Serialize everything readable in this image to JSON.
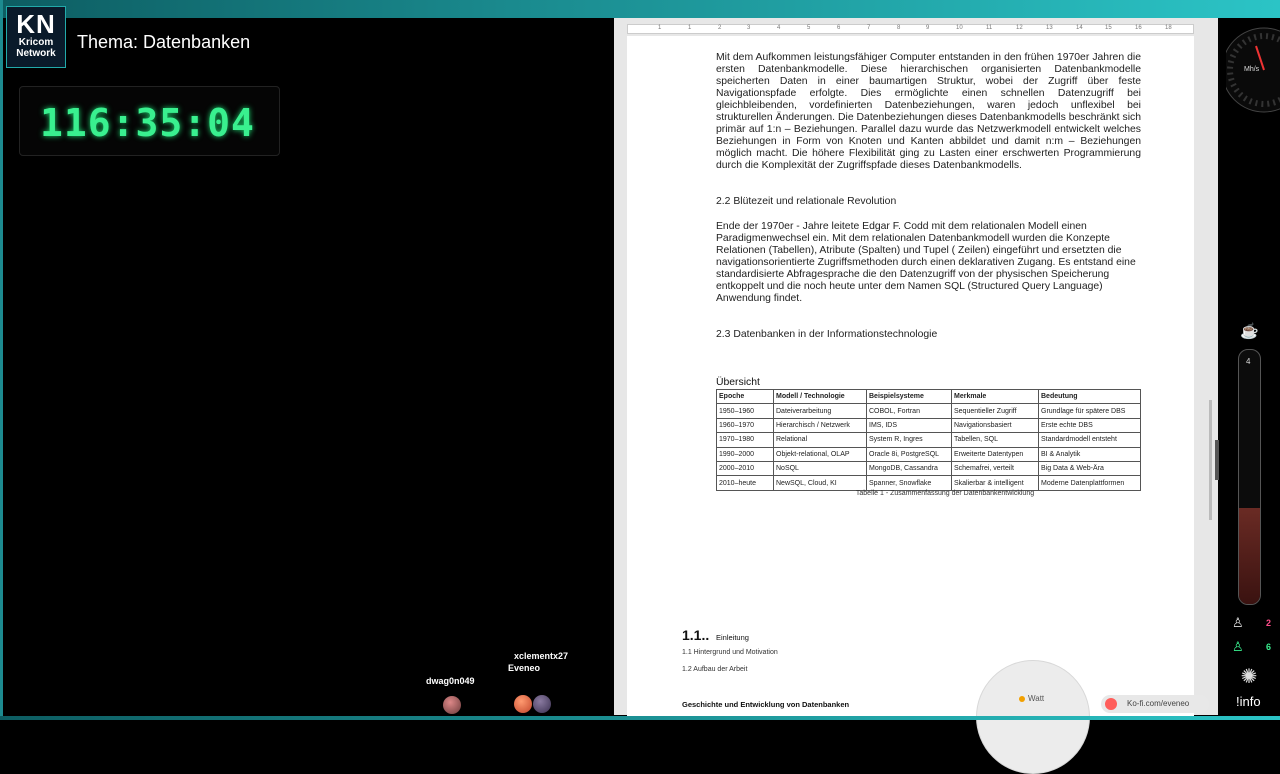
{
  "logo": {
    "letters": "KN",
    "line1": "Kricom",
    "line2": "Network"
  },
  "topic": "Thema: Datenbanken",
  "timer": "116:35:04",
  "viewers": [
    {
      "name": "dwag0n049"
    },
    {
      "name": "xclementx27"
    },
    {
      "name": "Eveneo"
    }
  ],
  "ruler_numbers": [
    "1",
    "1",
    "2",
    "3",
    "4",
    "5",
    "6",
    "7",
    "8",
    "9",
    "10",
    "11",
    "12",
    "13",
    "14",
    "15",
    "16",
    "18"
  ],
  "document": {
    "paragraph1": "Mit dem Aufkommen leistungsfähiger Computer entstanden in den frühen 1970er Jahren die ersten Datenbankmodelle. Diese hierarchischen organisierten Datenbankmodelle speicherten Daten in einer baumartigen Struktur, wobei der Zugriff über feste Navigationspfade erfolgte. Dies ermöglichte einen schnellen Datenzugriff bei gleichbleibenden, vordefinierten Datenbeziehungen, waren jedoch unflexibel bei strukturellen Änderungen. Die Datenbeziehungen dieses Datenbankmodells beschränkt sich primär auf 1:n – Beziehungen. Parallel dazu wurde das Netzwerkmodell entwickelt welches Beziehungen in Form von Knoten und Kanten abbildet und damit n:m – Beziehungen möglich macht. Die höhere Flexibilität ging zu Lasten einer erschwerten Programmierung durch die Komplexität der Zugriffspfade dieses Datenbankmodells.",
    "heading22": "2.2 Blütezeit und relationale Revolution",
    "paragraph2": "Ende der 1970er - Jahre leitete Edgar F. Codd mit dem relationalen Modell einen Paradigmenwechsel ein. Mit dem relationalen Datenbankmodell wurden die Konzepte Relationen (Tabellen), Atribute (Spalten) und Tupel ( Zeilen) eingeführt und ersetzten die navigationsorientierte Zugriffsmethoden durch einen deklarativen Zugang. Es entstand eine standardisierte Abfragesprache die den Datenzugriff von der physischen Speicherung entkoppelt und die noch heute unter dem Namen SQL (Structured Query Language) Anwendung findet.",
    "heading23": "2.3 Datenbanken in der Informationstechnologie",
    "table_title": "Übersicht",
    "table_headers": [
      "Epoche",
      "Modell / Technologie",
      "Beispielsysteme",
      "Merkmale",
      "Bedeutung"
    ],
    "table_rows": [
      [
        "1950–1960",
        "Dateiverarbeitung",
        "COBOL, Fortran",
        "Sequentieller Zugriff",
        "Grundlage für spätere DBS"
      ],
      [
        "1960–1970",
        "Hierarchisch / Netzwerk",
        "IMS, IDS",
        "Navigationsbasiert",
        "Erste echte DBS"
      ],
      [
        "1970–1980",
        "Relational",
        "System R, Ingres",
        "Tabellen, SQL",
        "Standardmodell entsteht"
      ],
      [
        "1990–2000",
        "Objekt-relational, OLAP",
        "Oracle 8i, PostgreSQL",
        "Erweiterte Datentypen",
        "BI & Analytik"
      ],
      [
        "2000–2010",
        "NoSQL",
        "MongoDB, Cassandra",
        "Schemafrei, verteilt",
        "Big Data & Web-Ära"
      ],
      [
        "2010–heute",
        "NewSQL, Cloud, KI",
        "Spanner, Snowflake",
        "Skalierbar & intelligent",
        "Moderne Datenplattformen"
      ]
    ],
    "table_caption": "Tabelle 1 - Zusammenfassung der Datenbankentwicklung",
    "section_number": "1.1..",
    "section_title": "Einleitung",
    "toc1": "1.1 Hintergrund und Motivation",
    "toc2": "1.2 Aufbau der Arbeit",
    "geschichte": "Geschichte und Entwicklung von Datenbanken"
  },
  "watt_gauge": {
    "label": "Watt"
  },
  "kofi": "Ko-fi.com/eveneo",
  "speedometer": {
    "unit": "Mh/s"
  },
  "tube_level": "4",
  "stats": [
    {
      "icon": "person-icon",
      "value": "2",
      "color": "#ff4d8a"
    },
    {
      "icon": "person-icon",
      "value": "6",
      "color": "#39f08f"
    }
  ],
  "info_label": "!info",
  "colors": {
    "accent": "#2bc4c6",
    "timer": "#39f08f"
  }
}
